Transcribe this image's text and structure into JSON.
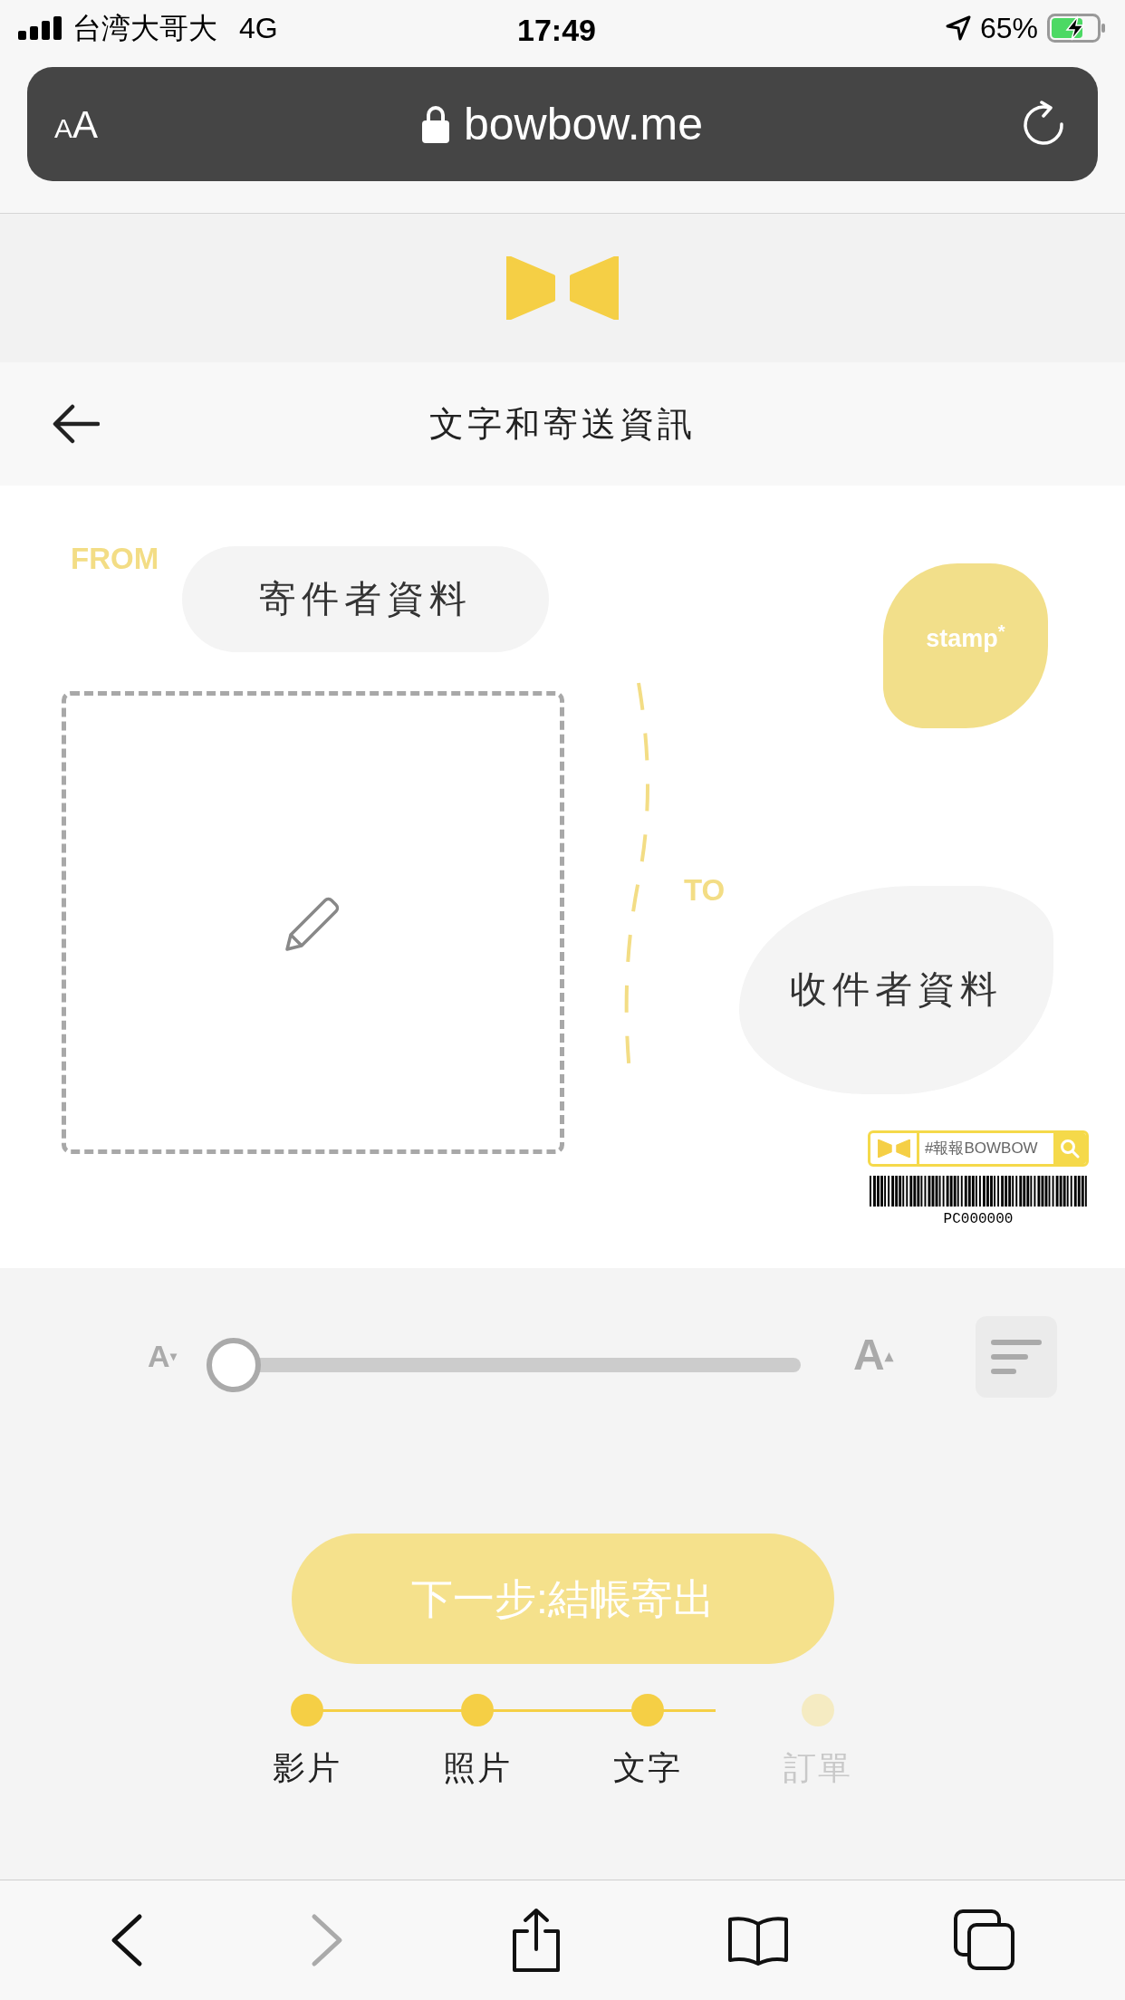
{
  "status_bar": {
    "carrier": "台湾大哥大",
    "network": "4G",
    "time": "17:49",
    "battery": "65%"
  },
  "address_bar": {
    "text_size": "AA",
    "url": "bowbow.me"
  },
  "header": {
    "title": "文字和寄送資訊"
  },
  "postcard": {
    "from_label": "FROM",
    "sender": "寄件者資料",
    "stamp": "stamp$^{*}$",
    "to_label": "TO",
    "recipient": "收件者資料",
    "tag": "#報報BOWBOW",
    "barcode_number": "PC000000"
  },
  "text_size_slider": {
    "smaller_icon": "A$^{▾}$",
    "level": 0,
    "larger_icon": "A$^{▴}$"
  },
  "next_button": "下一步:結帳寄出",
  "steps": [
    {
      "label": "影片",
      "done": true
    },
    {
      "label": "照片",
      "done": true
    },
    {
      "label": "文字",
      "done": true
    },
    {
      "label": "訂單",
      "done": false
    }
  ],
  "toolbar": {
    "back_enabled": true,
    "forward_enabled": false
  }
}
